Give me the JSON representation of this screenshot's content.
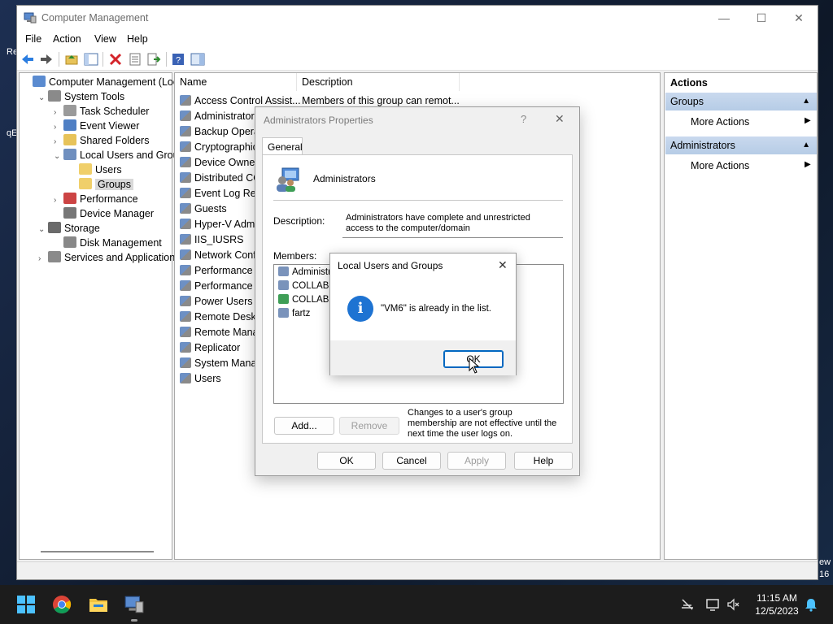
{
  "window": {
    "title": "Computer Management",
    "controls": {
      "minimize": "—",
      "maximize": "☐",
      "close": "✕"
    }
  },
  "menu": [
    "File",
    "Action",
    "View",
    "Help"
  ],
  "desktop_fragments": [
    "Re",
    "qE",
    "ew",
    "16"
  ],
  "tree": [
    {
      "label": "Computer Management (Local",
      "level": 0,
      "arrow": "",
      "icon": "computer-management-icon"
    },
    {
      "label": "System Tools",
      "level": 1,
      "arrow": "⌄",
      "icon": "tools-icon"
    },
    {
      "label": "Task Scheduler",
      "level": 2,
      "arrow": "›",
      "icon": "clock-icon"
    },
    {
      "label": "Event Viewer",
      "level": 2,
      "arrow": "›",
      "icon": "event-viewer-icon"
    },
    {
      "label": "Shared Folders",
      "level": 2,
      "arrow": "›",
      "icon": "shared-folder-icon"
    },
    {
      "label": "Local Users and Groups",
      "level": 2,
      "arrow": "⌄",
      "icon": "users-icon"
    },
    {
      "label": "Users",
      "level": 3,
      "arrow": "",
      "icon": "folder-icon"
    },
    {
      "label": "Groups",
      "level": 3,
      "arrow": "",
      "icon": "folder-icon",
      "selected": true
    },
    {
      "label": "Performance",
      "level": 2,
      "arrow": "›",
      "icon": "performance-icon"
    },
    {
      "label": "Device Manager",
      "level": 2,
      "arrow": "",
      "icon": "device-manager-icon"
    },
    {
      "label": "Storage",
      "level": 1,
      "arrow": "⌄",
      "icon": "storage-icon"
    },
    {
      "label": "Disk Management",
      "level": 2,
      "arrow": "",
      "icon": "disk-icon"
    },
    {
      "label": "Services and Applications",
      "level": 1,
      "arrow": "›",
      "icon": "services-icon"
    }
  ],
  "list": {
    "columns": [
      "Name",
      "Description"
    ],
    "rows": [
      {
        "name": "Access Control Assist...",
        "desc": "Members of this group can remot..."
      },
      {
        "name": "Administrators",
        "desc": ""
      },
      {
        "name": "Backup Operat",
        "desc": ""
      },
      {
        "name": "Cryptographic",
        "desc": ""
      },
      {
        "name": "Device Owners",
        "desc": ""
      },
      {
        "name": "Distributed CO",
        "desc": ""
      },
      {
        "name": "Event Log Rea",
        "desc": ""
      },
      {
        "name": "Guests",
        "desc": ""
      },
      {
        "name": "Hyper-V Admi",
        "desc": ""
      },
      {
        "name": "IIS_IUSRS",
        "desc": ""
      },
      {
        "name": "Network Confi",
        "desc": ""
      },
      {
        "name": "Performance L",
        "desc": ""
      },
      {
        "name": "Performance M",
        "desc": ""
      },
      {
        "name": "Power Users",
        "desc": ""
      },
      {
        "name": "Remote Deskto",
        "desc": ""
      },
      {
        "name": "Remote Manag",
        "desc": ""
      },
      {
        "name": "Replicator",
        "desc": ""
      },
      {
        "name": "System Manag",
        "desc": ""
      },
      {
        "name": "Users",
        "desc": ""
      }
    ]
  },
  "actions": {
    "header": "Actions",
    "sections": [
      {
        "title": "Groups",
        "item": "More Actions"
      },
      {
        "title": "Administrators",
        "item": "More Actions"
      }
    ]
  },
  "properties_dialog": {
    "title": "Administrators Properties",
    "help_glyph": "?",
    "close_glyph": "✕",
    "tab": "General",
    "group_name": "Administrators",
    "description_label": "Description:",
    "description_value": "Administrators have complete and unrestricted access to the computer/domain",
    "members_label": "Members:",
    "members": [
      "Administra",
      "COLLABN",
      "COLLABN",
      "fartz"
    ],
    "add_button": "Add...",
    "remove_button": "Remove",
    "note": "Changes to a user's group membership are not effective until the next time the user logs on.",
    "ok": "OK",
    "cancel": "Cancel",
    "apply": "Apply",
    "help": "Help"
  },
  "message_box": {
    "title": "Local Users and Groups",
    "close_glyph": "✕",
    "message": "\"VM6\" is already in the list.",
    "ok": "OK",
    "icon_glyph": "i"
  },
  "taskbar": {
    "time": "11:15 AM",
    "date": "12/5/2023"
  },
  "colors": {
    "accent": "#0067c0",
    "selected_tree": "#d9d9d9",
    "actions_header": "#c9d9ee",
    "info_icon": "#1e73d2"
  }
}
